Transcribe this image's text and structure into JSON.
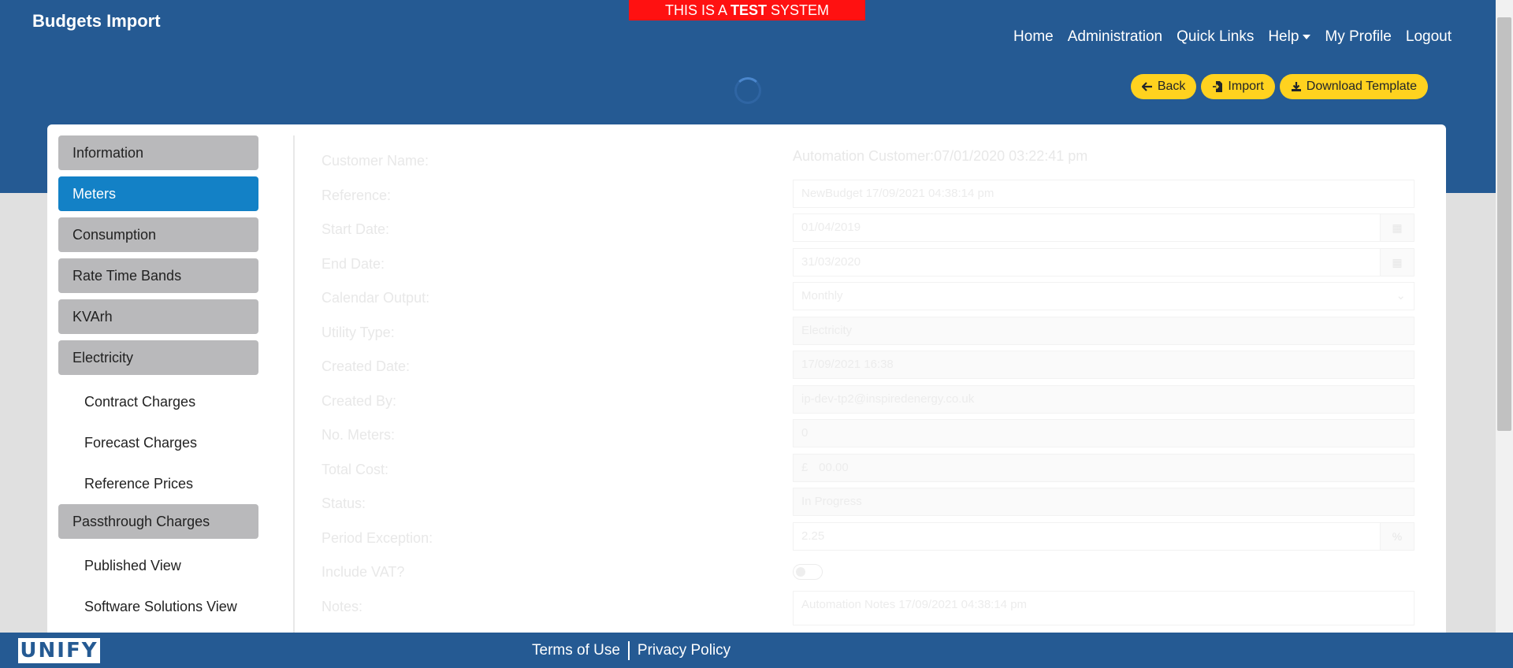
{
  "app": {
    "title": "Budgets Import"
  },
  "banner": {
    "prefix": "THIS IS A",
    "bold": "TEST",
    "suffix": "SYSTEM"
  },
  "nav": {
    "home": "Home",
    "admin": "Administration",
    "quick": "Quick Links",
    "help": "Help",
    "profile": "My Profile",
    "logout": "Logout"
  },
  "actions": {
    "back": "Back",
    "import": "Import",
    "download": "Download Template"
  },
  "sidebar": {
    "items": [
      {
        "label": "Information",
        "type": "item"
      },
      {
        "label": "Meters",
        "type": "item",
        "active": true
      },
      {
        "label": "Consumption",
        "type": "item"
      },
      {
        "label": "Rate Time Bands",
        "type": "item"
      },
      {
        "label": "KVArh",
        "type": "item"
      },
      {
        "label": "Electricity",
        "type": "item"
      },
      {
        "label": "Contract Charges",
        "type": "sub"
      },
      {
        "label": "Forecast Charges",
        "type": "sub"
      },
      {
        "label": "Reference Prices",
        "type": "sub"
      },
      {
        "label": "Passthrough Charges",
        "type": "item"
      },
      {
        "label": "Published View",
        "type": "sub"
      },
      {
        "label": "Software Solutions View",
        "type": "sub"
      }
    ]
  },
  "form": {
    "customer_name_label": "Customer Name:",
    "customer_name": "Automation Customer:07/01/2020 03:22:41 pm",
    "reference_label": "Reference:",
    "reference": "NewBudget 17/09/2021 04:38:14 pm",
    "start_label": "Start Date:",
    "start": "01/04/2019",
    "end_label": "End Date:",
    "end": "31/03/2020",
    "calendar_label": "Calendar Output:",
    "calendar": "Monthly",
    "utility_label": "Utility Type:",
    "utility": "Electricity",
    "created_date_label": "Created Date:",
    "created_date": "17/09/2021 16:38",
    "created_by_label": "Created By:",
    "created_by": "ip-dev-tp2@inspiredenergy.co.uk",
    "meters_label": "No. Meters:",
    "meters": "0",
    "cost_label": "Total Cost:",
    "currency": "£",
    "cost": "00.00",
    "status_label": "Status:",
    "status": "In Progress",
    "period_label": "Period Exception:",
    "period": "2.25",
    "percent": "%",
    "vat_label": "Include VAT?",
    "vat_on": false,
    "notes_label": "Notes:",
    "notes": "Automation Notes 17/09/2021 04:38:14 pm"
  },
  "footer": {
    "logo": "UNIFY",
    "terms": "Terms of Use",
    "privacy": "Privacy Policy"
  },
  "colors": {
    "header": "#255a93",
    "active": "#1381c6",
    "button": "#ffd21f",
    "banner": "#ff1111"
  }
}
